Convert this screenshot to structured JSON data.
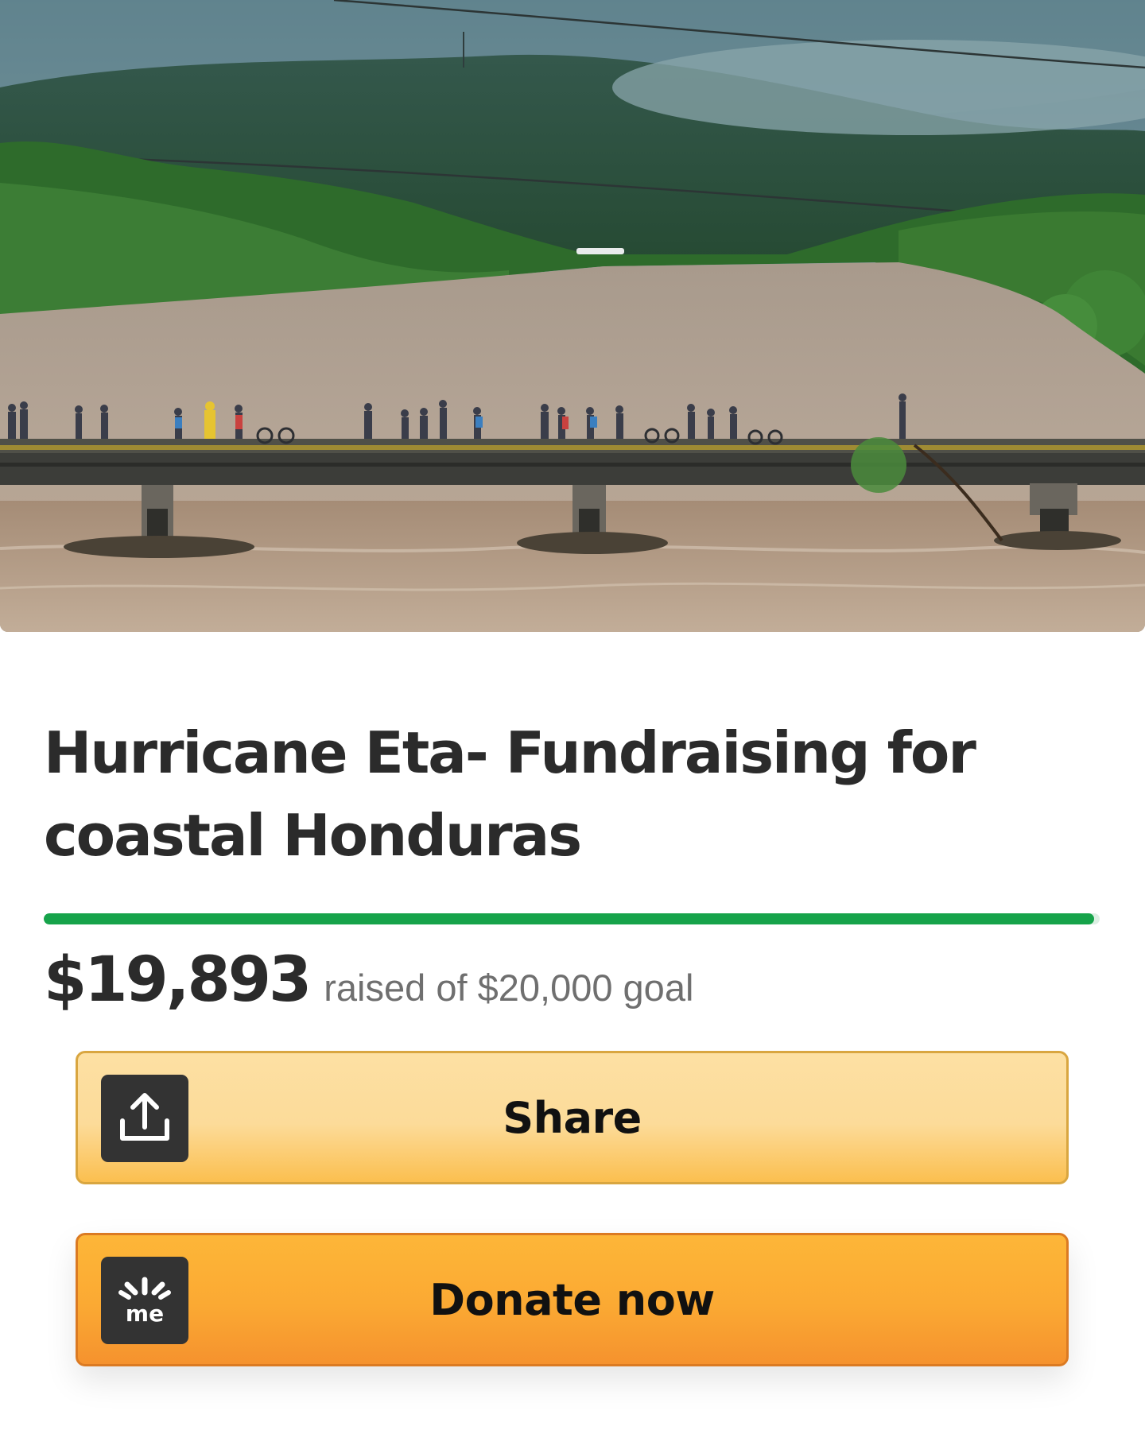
{
  "campaign": {
    "title": "Hurricane Eta- Fundraising for coastal Honduras",
    "raised_amount": "$19,893",
    "raised_text": "raised of $20,000 goal",
    "progress_fraction": 0.995
  },
  "buttons": {
    "share_label": "Share",
    "donate_label": "Donate now",
    "share_icon": "share-upload-icon",
    "donate_icon": "gofundme-logo-icon"
  },
  "logo_text": "me",
  "colors": {
    "progress": "#16a34a",
    "share_button": "#fcdb99",
    "donate_button": "#fba933",
    "icon_background": "#333333"
  }
}
